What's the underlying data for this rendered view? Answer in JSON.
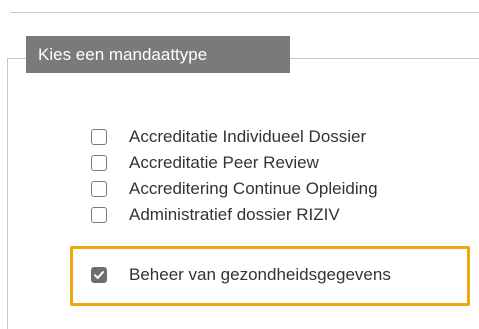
{
  "fieldset": {
    "legend": "Kies een mandaattype"
  },
  "options": [
    {
      "label": "Accreditatie Individueel Dossier",
      "checked": false
    },
    {
      "label": "Accreditatie Peer Review",
      "checked": false
    },
    {
      "label": "Accreditering Continue Opleiding",
      "checked": false
    },
    {
      "label": "Administratief dossier RIZIV",
      "checked": false
    },
    {
      "label": "Beheer van gezondheidsgegevens",
      "checked": true
    }
  ],
  "colors": {
    "legend_bg": "#7a7a7a",
    "highlight": "#f0a60f",
    "checkbox_checked": "#6e6e6e"
  },
  "icons": {
    "checkmark": "checkmark-icon"
  }
}
